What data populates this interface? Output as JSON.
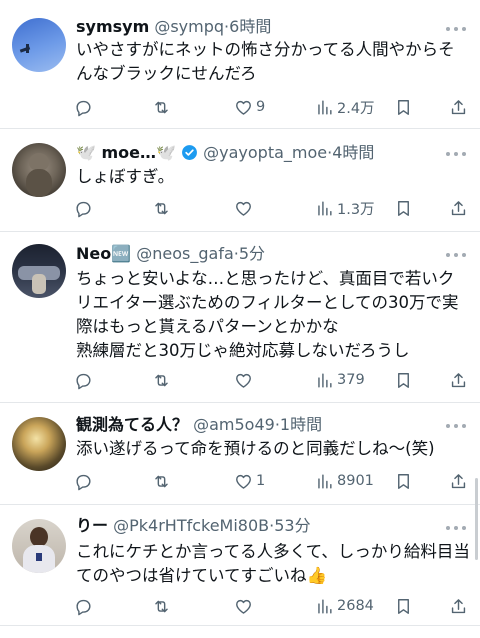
{
  "tweets": [
    {
      "name": "symsym",
      "handle": "@sympq",
      "time": "6時間",
      "text": "いやさすがにネットの怖さ分かってる人間やからそんなブラックにせんだろ",
      "reply": "",
      "retweet": "",
      "like": "9",
      "views": "2.4万"
    },
    {
      "name": "🕊️ moe…🕊️",
      "handle": "@yayopta_moe",
      "time": "4時間",
      "text": "しょぼすぎ。",
      "reply": "",
      "retweet": "",
      "like": "",
      "views": "1.3万"
    },
    {
      "name": "Neo🆕",
      "handle": "@neos_gafa",
      "time": "5分",
      "text": "ちょっと安いよな…と思ったけど、真面目で若いクリエイター選ぶためのフィルターとしての30万で実際はもっと貰えるパターンとかかな\n熟練層だと30万じゃ絶対応募しないだろうし",
      "reply": "",
      "retweet": "",
      "like": "",
      "views": "379"
    },
    {
      "name": "観測為てる人？",
      "handle": "@am5o49",
      "time": "1時間",
      "text": "添い遂げるって命を預けるのと同義だしね〜(笑)",
      "reply": "",
      "retweet": "",
      "like": "1",
      "views": "8901"
    },
    {
      "name": "りー",
      "handle": "@Pk4rHTfckeMi80B",
      "time": "53分",
      "text": "これにケチとか言ってる人多くて、しっかり給料目当てのやつは省けていてすごいね👍",
      "reply": "",
      "retweet": "",
      "like": "",
      "views": "2684"
    }
  ],
  "separator": "·",
  "icons": {
    "reply": "reply-icon",
    "retweet": "retweet-icon",
    "like": "heart-icon",
    "views": "views-bar-chart-icon",
    "bookmark": "bookmark-icon",
    "share": "share-icon",
    "more": "more-dots-icon",
    "verified": "verified-badge-icon"
  },
  "colors": {
    "text": "#0f1419",
    "secondary": "#536471",
    "verified": "#1d9bf0",
    "divider": "#e4e7ea"
  }
}
